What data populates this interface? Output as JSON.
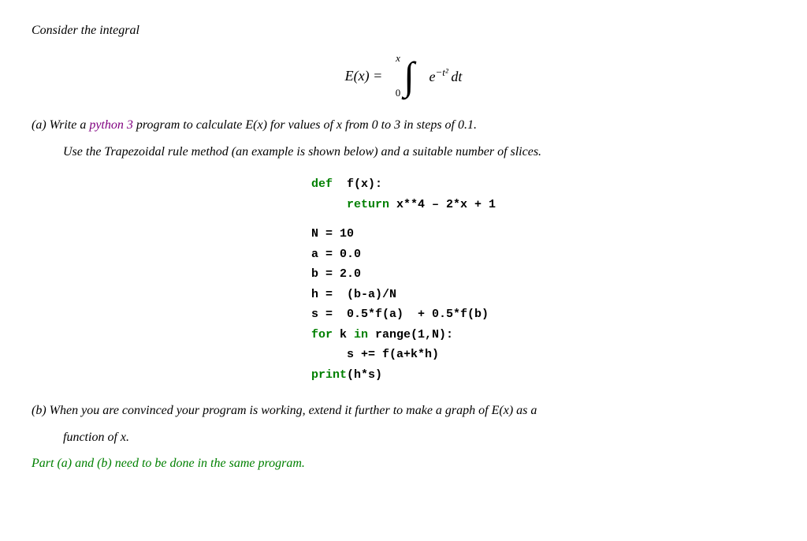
{
  "intro": {
    "label": "Consider the integral"
  },
  "equation": {
    "lhs": "E(x) =",
    "upper_limit": "x",
    "lower_limit": "0",
    "integrand": "e",
    "exponent": "−t²",
    "differential": "dt"
  },
  "part_a": {
    "prefix": "(a) Write a ",
    "python_keyword": "python 3",
    "middle": " program to calculate ",
    "math_Ex": "E(x)",
    "middle2": " for values of ",
    "x_var": "x",
    "middle3": " from 0 to 3 in steps of 0.1.",
    "sub_text": "Use the Trapezoidal rule method (an example is shown below) and a suitable number of slices."
  },
  "code": {
    "line1": "def  f(x):",
    "line2": "     return x**4 – 2*x + 1",
    "blank": "",
    "line3": "N = 10",
    "line4": "a = 0.0",
    "line5": "b = 2.0",
    "line6": "h =  (b-a)/N",
    "line7": "s =  0.5*f(a)  +  0.5*f(b)",
    "line8": "for k  in  range(1,N):",
    "line9": "     s += f(a+k*h)",
    "line10": "print(h*s)"
  },
  "part_b": {
    "prefix": "(b) When you are convinced your program is working, extend it further to make a graph of ",
    "math_Ex": "E(x)",
    "middle": " as a",
    "line2": "function of ",
    "x_var": "x",
    "end": "."
  },
  "green_note": "Part (a) and (b) need to be done in the same program."
}
